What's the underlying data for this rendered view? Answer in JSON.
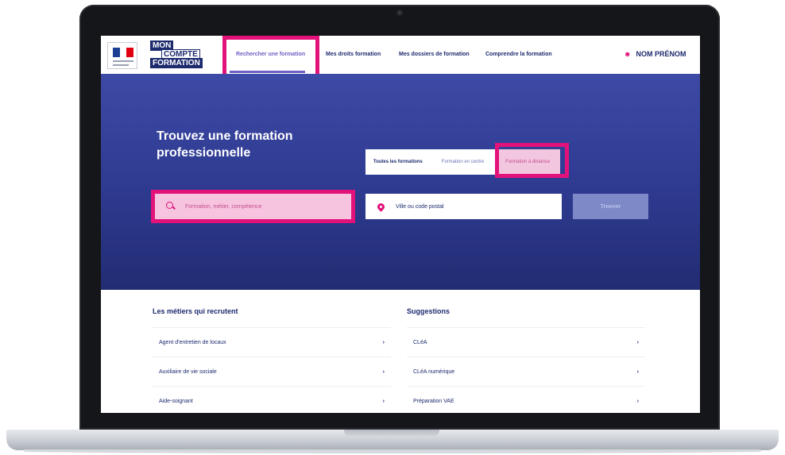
{
  "nav": {
    "links": [
      {
        "label": "Rechercher une formation"
      },
      {
        "label": "Mes droits formation"
      },
      {
        "label": "Mes dossiers de formation"
      },
      {
        "label": "Comprendre la formation"
      }
    ],
    "user": "NOM PRÉNOM",
    "user_icon": "user-icon"
  },
  "logo": {
    "line1": "MON",
    "line2": "COMPTE",
    "line3": "FORMATION"
  },
  "hero": {
    "title": "Trouvez une formation professionnelle",
    "tabs": [
      {
        "label": "Toutes les formations"
      },
      {
        "label": "Formation en centre"
      },
      {
        "label": "Formation à distance"
      }
    ],
    "search_placeholder": "Formation, métier, compétence",
    "city_placeholder": "Ville ou code postal",
    "find_button": "Trouver"
  },
  "lists": {
    "jobs": {
      "title": "Les métiers qui recrutent",
      "items": [
        {
          "label": "Agent d'entretien de locaux"
        },
        {
          "label": "Auxiliaire de vie sociale"
        },
        {
          "label": "Aide-soignant"
        }
      ]
    },
    "suggestions": {
      "title": "Suggestions",
      "items": [
        {
          "label": "CLéA"
        },
        {
          "label": "CLéA numérique"
        },
        {
          "label": "Préparation VAE"
        }
      ]
    }
  },
  "colors": {
    "brand_navy": "#1c2a6e",
    "hero_blue": "#2e3a8f",
    "highlight_pink": "#e2127a",
    "light_pink": "#f6c4df"
  }
}
